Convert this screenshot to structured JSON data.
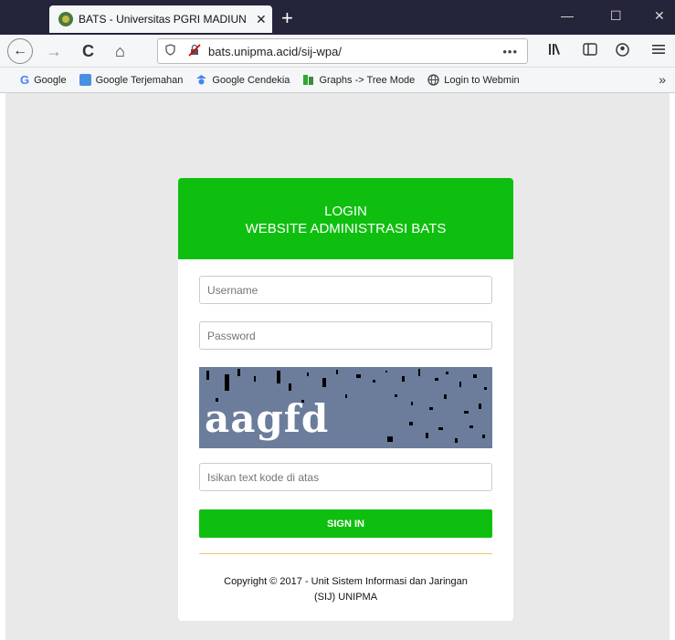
{
  "browser": {
    "tab_title": "BATS - Universitas PGRI MADIUN",
    "tab_close": "✕",
    "new_tab": "+",
    "url": "bats.unipma.acid/sij-wpa/",
    "url_more": "•••",
    "window_controls": {
      "minimize": "—",
      "maximize": "☐",
      "close": "✕"
    }
  },
  "nav": {
    "back": "←",
    "forward": "→",
    "reload": "C",
    "home": "⌂"
  },
  "bookmarks": [
    {
      "label": "Google",
      "icon": "google-icon",
      "color": "#4285f4"
    },
    {
      "label": "Google Terjemahan",
      "icon": "translate-icon",
      "color": "#4a90e2"
    },
    {
      "label": "Google Cendekia",
      "icon": "scholar-icon",
      "color": "#4285f4"
    },
    {
      "label": "Graphs -> Tree Mode",
      "icon": "graph-icon",
      "color": "#2eaa2e"
    },
    {
      "label": "Login to Webmin",
      "icon": "globe-icon",
      "color": "#555555"
    }
  ],
  "bookmarks_overflow": "»",
  "login": {
    "heading_line1": "LOGIN",
    "heading_line2": "WEBSITE ADMINISTRASI BATS",
    "username_placeholder": "Username",
    "password_placeholder": "Password",
    "captcha_text": "aagfd",
    "captcha_placeholder": "Isikan text kode di atas",
    "signin_label": "SIGN IN",
    "copyright_line1": "Copyright © 2017 - Unit Sistem Informasi dan Jaringan",
    "copyright_line2": "(SIJ) UNIPMA"
  },
  "colors": {
    "accent": "#0fbf0f",
    "divider": "#f0c06a",
    "titlebar": "#24253a"
  }
}
